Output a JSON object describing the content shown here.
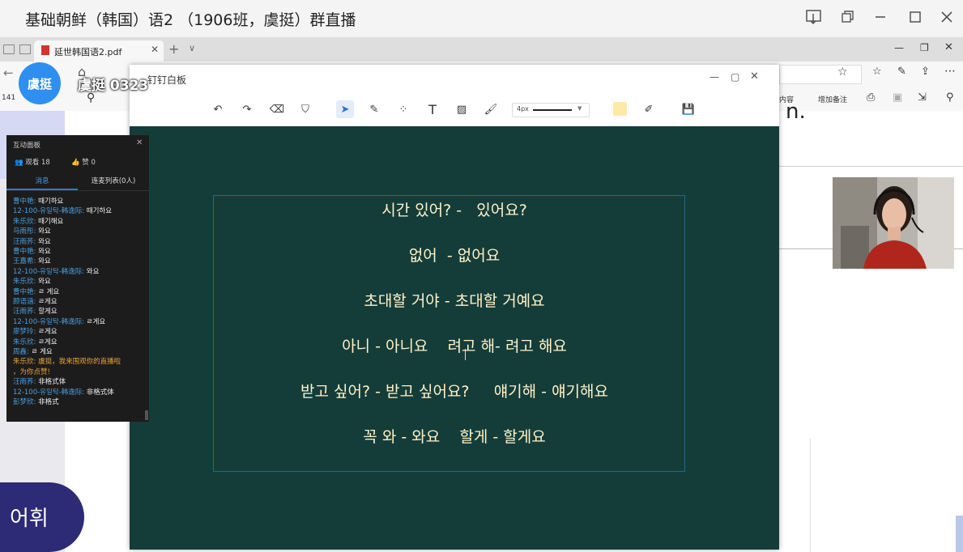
{
  "app": {
    "title": "基础朝鲜（韩国）语2 （1906班，虞挺）群直播",
    "window_buttons": [
      "pin-window",
      "restore-down",
      "minimize",
      "maximize",
      "close"
    ]
  },
  "browser": {
    "tab_label": "延世韩国语2.pdf",
    "page_number": "141",
    "toolbar_right": [
      "内容",
      "增加备注"
    ],
    "doc_fragment": "n."
  },
  "streamer": {
    "avatar_text": "虞挺",
    "name": "虞挺 0323"
  },
  "whiteboard": {
    "title": "钉钉白板",
    "pen_size": "4px",
    "highlight_color": "#fde9a8",
    "background_color": "#143d3a",
    "lines": [
      "시간 있어? -   있어요?",
      "없어  - 없어요",
      "초대할 거야 - 초대할 거예요",
      "아니 - 아니요    려고 해- 려고 해요",
      "받고 싶어? - 받고 싶어요?     얘기해 - 얘기해요",
      "꼭 와 - 와요    할게 - 할게요"
    ]
  },
  "panel": {
    "title": "互动面板",
    "viewers": "观看 18",
    "likes": "赞 0",
    "tabs": [
      "消息",
      "连麦列表(0人)"
    ],
    "messages": [
      {
        "name": "曹中艳:",
        "text": "때기하요"
      },
      {
        "name": "12-100-유일탁-韩逸际:",
        "text": "때기하요"
      },
      {
        "name": "朱乐欣:",
        "text": "때기해요"
      },
      {
        "name": "马雨彤:",
        "text": "와요"
      },
      {
        "name": "汪雨荞:",
        "text": "와요"
      },
      {
        "name": "曹中艳:",
        "text": "와요"
      },
      {
        "name": "王嘉希:",
        "text": "와요"
      },
      {
        "name": "12-100-유일탁-韩逸际:",
        "text": "와요"
      },
      {
        "name": "朱乐欣:",
        "text": "와요"
      },
      {
        "name": "曹中艳:",
        "text": "ㄹ 게요"
      },
      {
        "name": "顾语涵:",
        "text": "ㄹ게요"
      },
      {
        "name": "汪雨荞:",
        "text": "할게요"
      },
      {
        "name": "12-100-유일탁-韩逸际:",
        "text": "ㄹ게요"
      },
      {
        "name": "廖梦玲:",
        "text": "ㄹ게요"
      },
      {
        "name": "朱乐欣:",
        "text": "ㄹ게요"
      },
      {
        "name": "周鑫:",
        "text": "ㄹ 게요"
      },
      {
        "name": "朱乐欣:",
        "text": "虞挺，我来围观你的直播啦",
        "warn": true
      },
      {
        "name": "",
        "text": "，为你点赞!",
        "warn": true
      },
      {
        "name": "汪雨荞:",
        "text": "非格式体"
      },
      {
        "name": "12-100-유일탁-韩逸际:",
        "text": "非格式体"
      },
      {
        "name": "彭梦欣:",
        "text": "非格式"
      }
    ]
  },
  "sidebar_badge": "어휘"
}
